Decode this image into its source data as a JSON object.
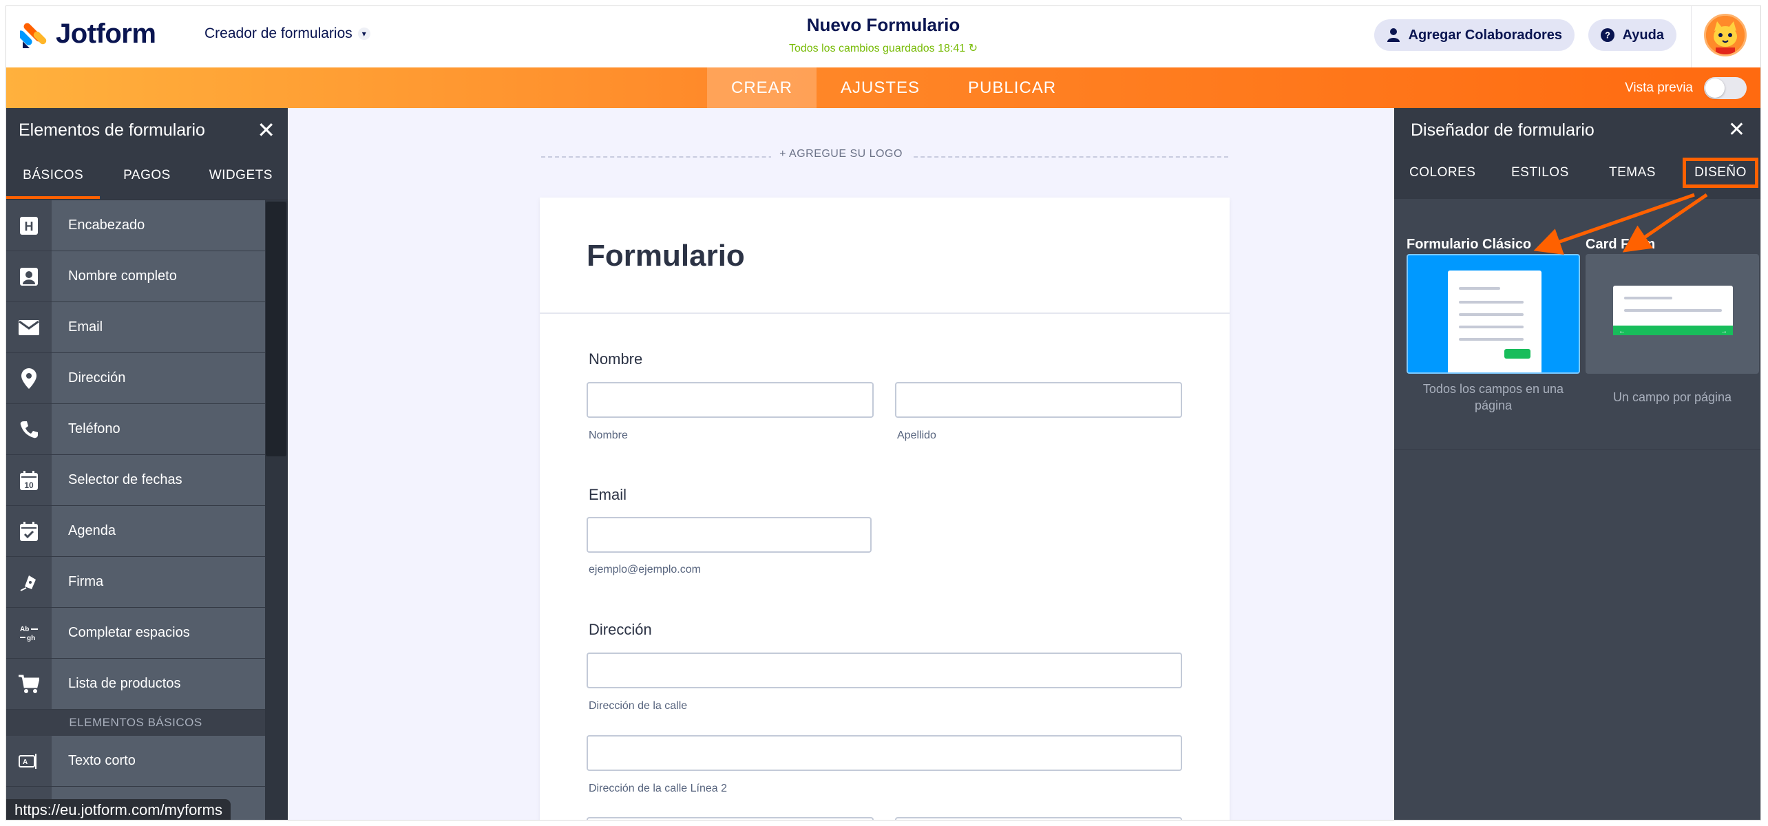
{
  "header": {
    "logo_text": "Jotform",
    "builder_label": "Creador de formularios",
    "form_name": "Nuevo Formulario",
    "saved_status": "Todos los cambios guardados 18:41",
    "collaborators_label": "Agregar Colaboradores",
    "help_label": "Ayuda"
  },
  "nav": {
    "tabs": [
      {
        "label": "CREAR",
        "active": true
      },
      {
        "label": "AJUSTES",
        "active": false
      },
      {
        "label": "PUBLICAR",
        "active": false
      }
    ],
    "preview_label": "Vista previa",
    "preview_on": false
  },
  "left_panel": {
    "title": "Elementos de formulario",
    "tabs": [
      {
        "label": "BÁSICOS",
        "active": true
      },
      {
        "label": "PAGOS",
        "active": false
      },
      {
        "label": "WIDGETS",
        "active": false
      }
    ],
    "items": [
      {
        "label": "Encabezado",
        "icon": "heading-icon"
      },
      {
        "label": "Nombre completo",
        "icon": "person-icon"
      },
      {
        "label": "Email",
        "icon": "envelope-icon"
      },
      {
        "label": "Dirección",
        "icon": "map-pin-icon"
      },
      {
        "label": "Teléfono",
        "icon": "phone-icon"
      },
      {
        "label": "Selector de fechas",
        "icon": "calendar-date-icon"
      },
      {
        "label": "Agenda",
        "icon": "calendar-check-icon"
      },
      {
        "label": "Firma",
        "icon": "pen-icon"
      },
      {
        "label": "Completar espacios",
        "icon": "fill-blank-icon"
      },
      {
        "label": "Lista de productos",
        "icon": "cart-icon"
      }
    ],
    "section_label": "ELEMENTOS BÁSICOS",
    "section_items": [
      {
        "label": "Texto corto",
        "icon": "short-text-icon"
      }
    ],
    "status_url": "https://eu.jotform.com/myforms"
  },
  "canvas": {
    "add_logo_label": "+ AGREGUE SU LOGO",
    "form_title": "Formulario",
    "fields": {
      "nombre": {
        "label": "Nombre",
        "first_sub": "Nombre",
        "last_sub": "Apellido"
      },
      "email": {
        "label": "Email",
        "sub": "ejemplo@ejemplo.com"
      },
      "direccion": {
        "label": "Dirección",
        "street_sub": "Dirección de la calle",
        "street2_sub": "Dirección de la calle Línea 2"
      }
    }
  },
  "right_panel": {
    "title": "Diseñador de formulario",
    "tabs": [
      {
        "label": "COLORES",
        "active": false
      },
      {
        "label": "ESTILOS",
        "active": false
      },
      {
        "label": "TEMAS",
        "active": false
      },
      {
        "label": "DISEÑO",
        "active": true
      }
    ],
    "layouts": [
      {
        "title": "Formulario Clásico",
        "caption": "Todos los campos en una página",
        "selected": true
      },
      {
        "title": "Card Form",
        "caption": "Un campo por página",
        "selected": false
      }
    ]
  },
  "colors": {
    "brand_orange": "#ff6100",
    "navy": "#0a1551",
    "saved_green": "#78bb07",
    "selected_blue": "#0099ff",
    "card_green": "#18bd5b"
  }
}
